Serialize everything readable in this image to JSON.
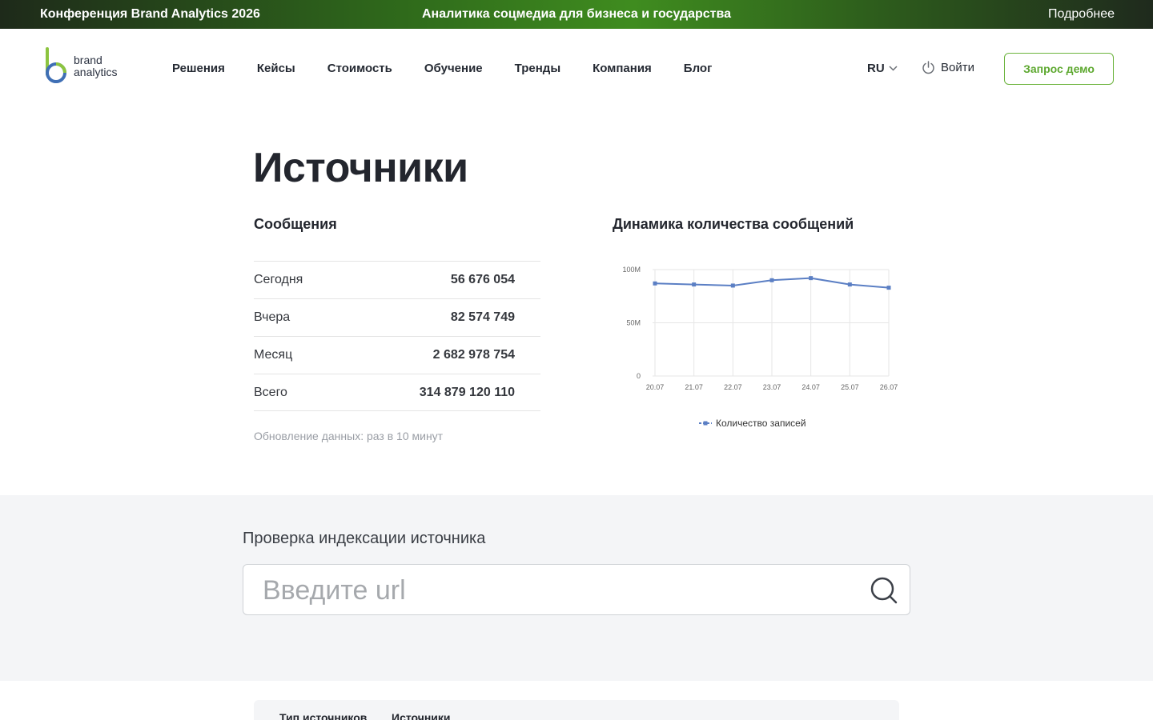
{
  "banner": {
    "left": "Конференция Brand Analytics 2026",
    "center": "Аналитика соцмедиа для бизнеса и государства",
    "right": "Подробнее"
  },
  "logo": {
    "line1": "brand",
    "line2": "analytics"
  },
  "nav": [
    "Решения",
    "Кейсы",
    "Стоимость",
    "Обучение",
    "Тренды",
    "Компания",
    "Блог"
  ],
  "lang": "RU",
  "login": "Войти",
  "demo_button": "Запрос демо",
  "page_title": "Источники",
  "messages": {
    "title": "Сообщения",
    "rows": [
      {
        "label": "Сегодня",
        "value": "56 676 054"
      },
      {
        "label": "Вчера",
        "value": "82 574 749"
      },
      {
        "label": "Месяц",
        "value": "2 682 978 754"
      },
      {
        "label": "Всего",
        "value": "314 879 120 110"
      }
    ],
    "note": "Обновление данных: раз в 10 минут"
  },
  "chart_title": "Динамика количества сообщений",
  "chart_data": {
    "type": "line",
    "categories": [
      "20.07",
      "21.07",
      "22.07",
      "23.07",
      "24.07",
      "25.07",
      "26.07"
    ],
    "series": [
      {
        "name": "Количество записей",
        "values": [
          87,
          86,
          85,
          90,
          92,
          86,
          83
        ]
      }
    ],
    "value_unit": "M",
    "ylim": [
      0,
      100
    ],
    "yticks": [
      "0",
      "50M",
      "100M"
    ],
    "grid": true,
    "legend_position": "bottom",
    "color": "#5b7fc4"
  },
  "index_check": {
    "title": "Проверка индексации источника",
    "placeholder": "Введите url"
  },
  "tabs": [
    "Тип источников",
    "Источники"
  ],
  "colors": {
    "accent": "#6bb33c",
    "line": "#5b7fc4"
  }
}
